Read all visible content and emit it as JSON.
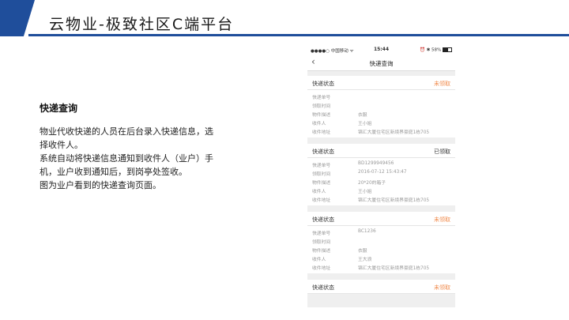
{
  "slide": {
    "title": "云物业-极致社区C端平台",
    "accent_color": "#1f4e9b"
  },
  "description": {
    "heading": "快递查询",
    "lines": [
      "物业代收快递的人员在后台录入快递信息，选",
      "择收件人。",
      "系统自动将快递信息通知到收件人（业户）手",
      "机，业户收到通知后，到岗亭处签收。",
      "图为业户看到的快递查询页面。"
    ]
  },
  "phone": {
    "status_bar": {
      "carrier": "●●●●○ 中国移动 ᯤ",
      "time": "15:44",
      "battery": "⏰ ✱ 58%"
    },
    "nav": {
      "back_icon": "chevron-left",
      "title": "快递查询"
    },
    "status_colors": {
      "pending": "#f08a4b",
      "received": "#333333"
    },
    "cards": [
      {
        "header_label": "快递状态",
        "status": "未领取",
        "status_kind": "pending",
        "fields": [
          {
            "label": "快递单号",
            "value": ""
          },
          {
            "label": "领取时间",
            "value": ""
          },
          {
            "label": "物件描述",
            "value": "衣服"
          },
          {
            "label": "收件人",
            "value": "王小姐"
          },
          {
            "label": "收件地址",
            "value": "锦汇大厦住宅区新境界豪庭1栋705"
          }
        ]
      },
      {
        "header_label": "快递状态",
        "status": "已领取",
        "status_kind": "received",
        "fields": [
          {
            "label": "快递单号",
            "value": "BD1299949456"
          },
          {
            "label": "领取时间",
            "value": "2016-07-12 15:43:47"
          },
          {
            "label": "物件描述",
            "value": "20*20的箱子"
          },
          {
            "label": "收件人",
            "value": "王小姐"
          },
          {
            "label": "收件地址",
            "value": "锦汇大厦住宅区新境界豪庭1栋705"
          }
        ]
      },
      {
        "header_label": "快递状态",
        "status": "未领取",
        "status_kind": "pending",
        "fields": [
          {
            "label": "快递单号",
            "value": "BC1236"
          },
          {
            "label": "领取时间",
            "value": ""
          },
          {
            "label": "物件描述",
            "value": "衣服"
          },
          {
            "label": "收件人",
            "value": "王大浪"
          },
          {
            "label": "收件地址",
            "value": "锦汇大厦住宅区新境界豪庭1栋705"
          }
        ]
      },
      {
        "header_label": "快递状态",
        "status": "未领取",
        "status_kind": "pending",
        "fields": []
      }
    ]
  }
}
